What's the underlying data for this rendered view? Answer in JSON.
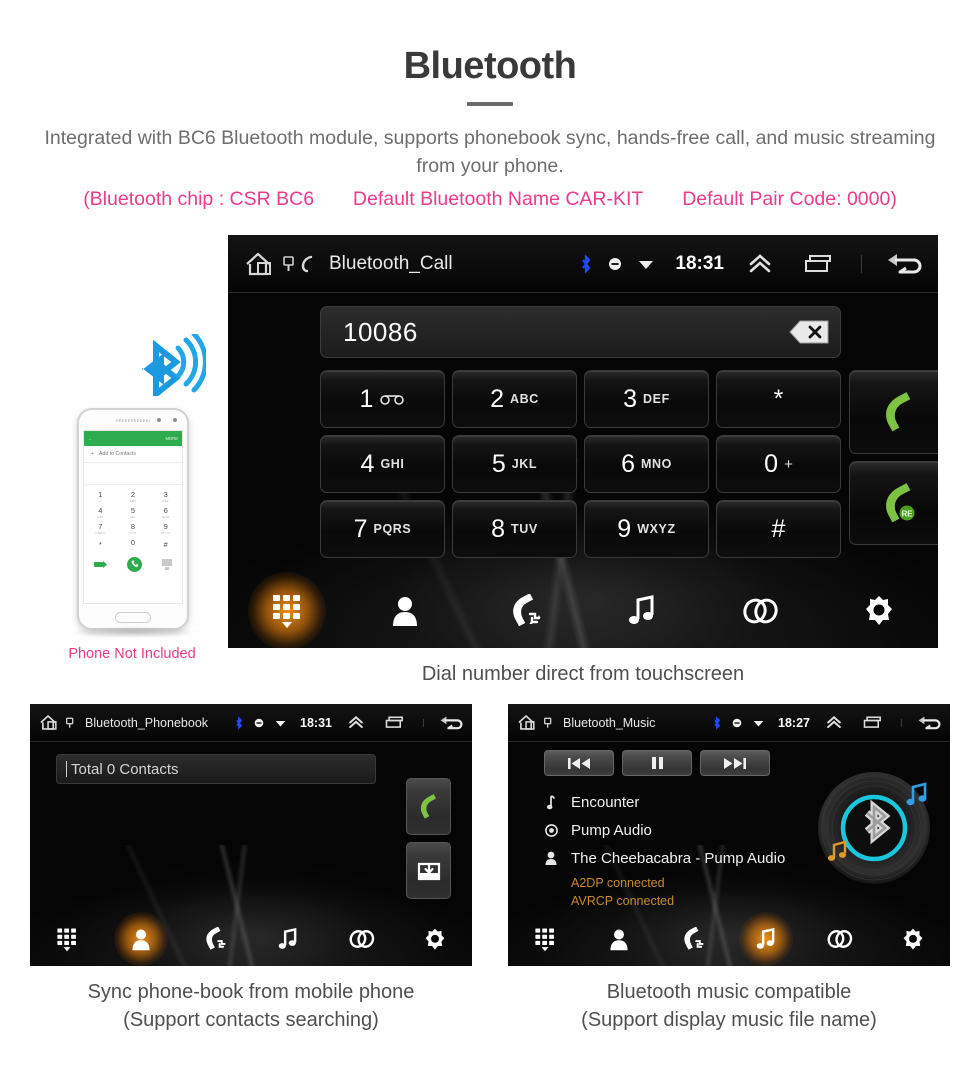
{
  "header": {
    "title": "Bluetooth",
    "subtitle": "Integrated with BC6 Bluetooth module, supports phonebook sync, hands-free call, and music streaming from your phone.",
    "spec_chip": "(Bluetooth chip : CSR BC6",
    "spec_name": "Default Bluetooth Name CAR-KIT",
    "spec_pair": "Default Pair Code: 0000)",
    "accent_pink": "#ec3b8c"
  },
  "main_screen": {
    "statusbar": {
      "title": "Bluetooth_Call",
      "time": "18:31",
      "icons": [
        "home-icon",
        "sim-card-icon",
        "phone-handset-icon",
        "bluetooth-icon",
        "mute-icon",
        "wifi-icon",
        "chevron-up-icon",
        "recents-icon",
        "back-arrow-icon"
      ]
    },
    "display": {
      "number": "10086",
      "backspace_label": "backspace-icon"
    },
    "keys": [
      {
        "digit": "1",
        "letters": "",
        "special": "voicemail"
      },
      {
        "digit": "2",
        "letters": "ABC",
        "special": ""
      },
      {
        "digit": "3",
        "letters": "DEF",
        "special": ""
      },
      {
        "digit": "*",
        "letters": "",
        "special": "symbol"
      },
      {
        "digit": "4",
        "letters": "GHI",
        "special": ""
      },
      {
        "digit": "5",
        "letters": "JKL",
        "special": ""
      },
      {
        "digit": "6",
        "letters": "MNO",
        "special": ""
      },
      {
        "digit": "0",
        "letters": "+",
        "special": "plus"
      },
      {
        "digit": "7",
        "letters": "PQRS",
        "special": ""
      },
      {
        "digit": "8",
        "letters": "TUV",
        "special": ""
      },
      {
        "digit": "9",
        "letters": "WXYZ",
        "special": ""
      },
      {
        "digit": "#",
        "letters": "",
        "special": "symbol"
      }
    ],
    "call_buttons": [
      {
        "name": "call-button",
        "badge": ""
      },
      {
        "name": "redial-button",
        "badge": "RE"
      }
    ],
    "nav": [
      {
        "name": "dialpad",
        "active": true
      },
      {
        "name": "contacts",
        "active": false
      },
      {
        "name": "call-history",
        "active": false
      },
      {
        "name": "music",
        "active": false
      },
      {
        "name": "link",
        "active": false
      },
      {
        "name": "settings",
        "active": false
      }
    ],
    "caption": "Dial number direct from touchscreen"
  },
  "phone_mock": {
    "header_back": "←",
    "header_more": "MORE",
    "add_contacts": "Add to Contacts",
    "keys": [
      {
        "d": "1",
        "s": "∞"
      },
      {
        "d": "2",
        "s": "ABC"
      },
      {
        "d": "3",
        "s": "DEF"
      },
      {
        "d": "4",
        "s": "GHI"
      },
      {
        "d": "5",
        "s": "JKL"
      },
      {
        "d": "6",
        "s": "MNO"
      },
      {
        "d": "7",
        "s": "PQRS"
      },
      {
        "d": "8",
        "s": "TUV"
      },
      {
        "d": "9",
        "s": "WXYZ"
      },
      {
        "d": "*",
        "s": ""
      },
      {
        "d": "0",
        "s": "+"
      },
      {
        "d": "#",
        "s": ""
      }
    ],
    "note": "Phone Not Included"
  },
  "phonebook_screen": {
    "statusbar": {
      "title": "Bluetooth_Phonebook",
      "time": "18:31"
    },
    "search_placeholder": "Total 0 Contacts",
    "side_buttons": [
      {
        "name": "call-button"
      },
      {
        "name": "download-contacts-button"
      }
    ],
    "nav": [
      {
        "name": "dialpad",
        "active": false
      },
      {
        "name": "contacts",
        "active": true
      },
      {
        "name": "call-history",
        "active": false
      },
      {
        "name": "music",
        "active": false
      },
      {
        "name": "link",
        "active": false
      },
      {
        "name": "settings",
        "active": false
      }
    ],
    "caption_line1": "Sync phone-book from mobile phone",
    "caption_line2": "(Support contacts searching)"
  },
  "music_screen": {
    "statusbar": {
      "title": "Bluetooth_Music",
      "time": "18:27"
    },
    "controls": [
      {
        "name": "previous-track-button"
      },
      {
        "name": "pause-button"
      },
      {
        "name": "next-track-button"
      }
    ],
    "track": {
      "title": "Encounter",
      "album": "Pump Audio",
      "artist": "The Cheebacabra - Pump Audio",
      "status_a2dp": "A2DP connected",
      "status_avrcp": "AVRCP connected",
      "status_color": "#c88a2a"
    },
    "nav": [
      {
        "name": "dialpad",
        "active": false
      },
      {
        "name": "contacts",
        "active": false
      },
      {
        "name": "call-history",
        "active": false
      },
      {
        "name": "music",
        "active": true
      },
      {
        "name": "link",
        "active": false
      },
      {
        "name": "settings",
        "active": false
      }
    ],
    "caption_line1": "Bluetooth music compatible",
    "caption_line2": "(Support display music file name)"
  }
}
